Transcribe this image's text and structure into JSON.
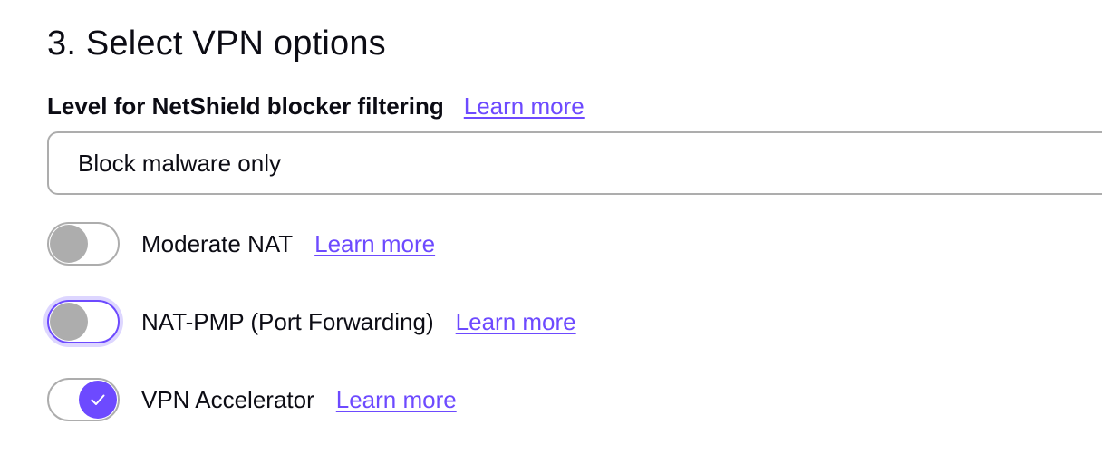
{
  "section": {
    "title": "3. Select VPN options"
  },
  "netshield": {
    "label": "Level for NetShield blocker filtering",
    "learn_more": "Learn more",
    "selected_value": "Block malware only"
  },
  "options": [
    {
      "label": "Moderate NAT",
      "learn_more": "Learn more",
      "checked": false
    },
    {
      "label": "NAT-PMP (Port Forwarding)",
      "learn_more": "Learn more",
      "checked": false,
      "focused": true
    },
    {
      "label": "VPN Accelerator",
      "learn_more": "Learn more",
      "checked": true
    }
  ],
  "colors": {
    "accent": "#6d4aff",
    "toggle_off": "#adadad",
    "text": "#0c0c14"
  },
  "icons": {
    "toggle_checked": "check-icon"
  }
}
